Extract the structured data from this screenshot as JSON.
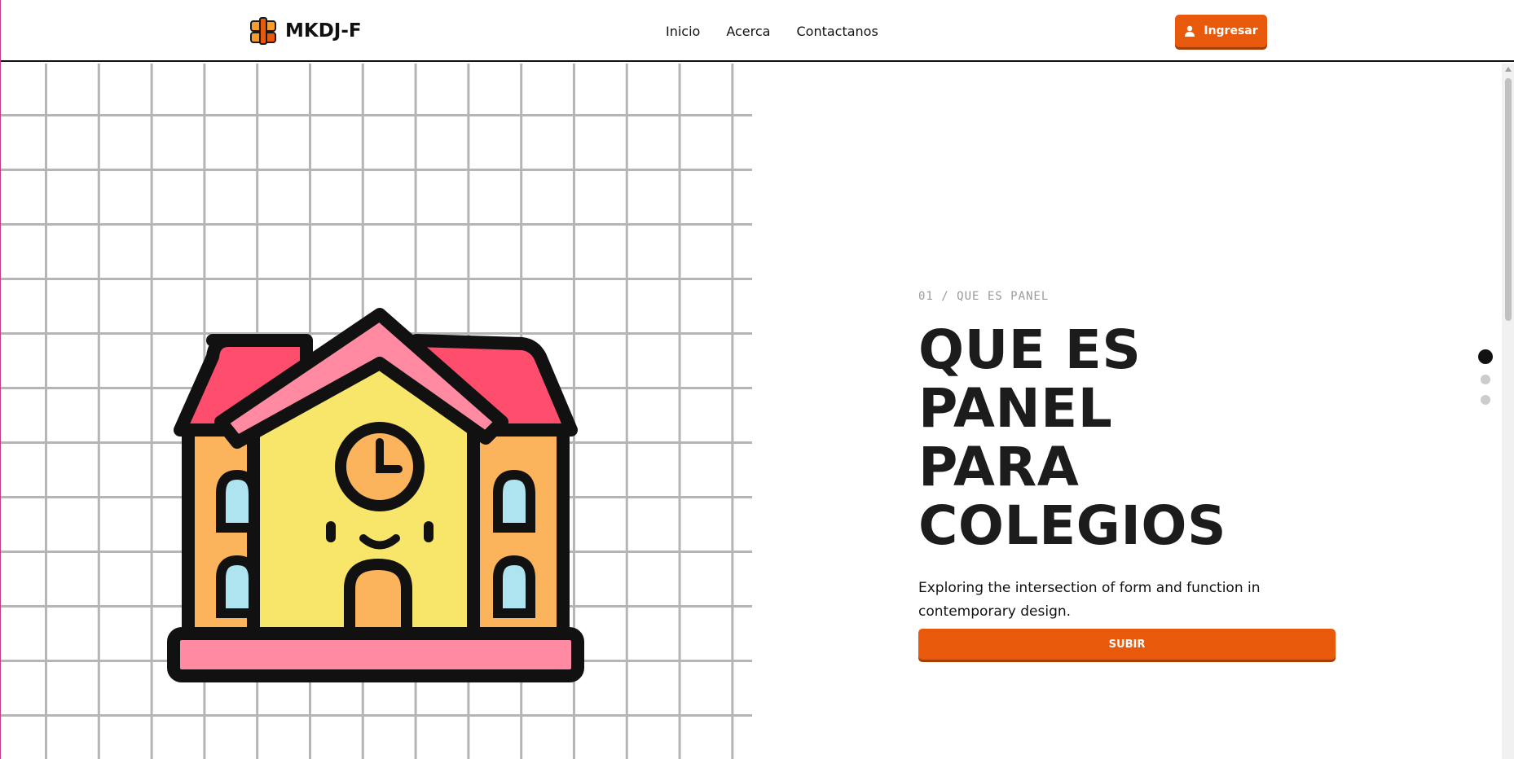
{
  "header": {
    "brand": "MKDJ-F",
    "nav": [
      {
        "label": "Inicio"
      },
      {
        "label": "Acerca"
      },
      {
        "label": "Contactanos"
      }
    ],
    "login_label": "Ingresar"
  },
  "hero": {
    "eyebrow": "01 / QUE ES PANEL",
    "headline_lines": [
      "QUE ES PANEL",
      "PARA",
      "COLEGIOS"
    ],
    "description": "Exploring the intersection of form and function in contemporary design.",
    "cta_label": "SUBIR",
    "illustration_icon": "school-building-icon"
  },
  "pagination": {
    "total": 3,
    "active_index": 0
  },
  "colors": {
    "accent": "#e8590c",
    "text": "#1c1c1c",
    "grid": "#b5b5b5"
  }
}
